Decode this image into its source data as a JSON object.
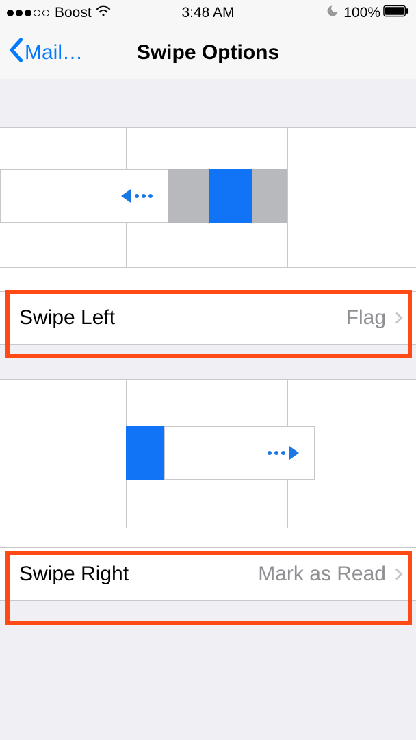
{
  "status": {
    "carrier": "Boost",
    "time": "3:48 AM",
    "battery_percent": "100%"
  },
  "nav": {
    "back_label": "Mail…",
    "title": "Swipe Options"
  },
  "rows": {
    "swipe_left": {
      "label": "Swipe Left",
      "value": "Flag"
    },
    "swipe_right": {
      "label": "Swipe Right",
      "value": "Mark as Read"
    }
  },
  "colors": {
    "accent": "#007aff",
    "action_blue": "#1174f6",
    "action_gray": "#b7b9bd",
    "highlight": "#ff4a16"
  },
  "icons": {
    "signal_filled": 3,
    "signal_total": 5,
    "wifi": "wifi-icon",
    "dnd": "moon-icon",
    "battery": "battery-icon",
    "back": "chevron-left-icon",
    "disclosure": "chevron-right-icon",
    "swipe_left_arrow": "arrow-left-dotted-icon",
    "swipe_right_arrow": "arrow-right-dotted-icon"
  }
}
